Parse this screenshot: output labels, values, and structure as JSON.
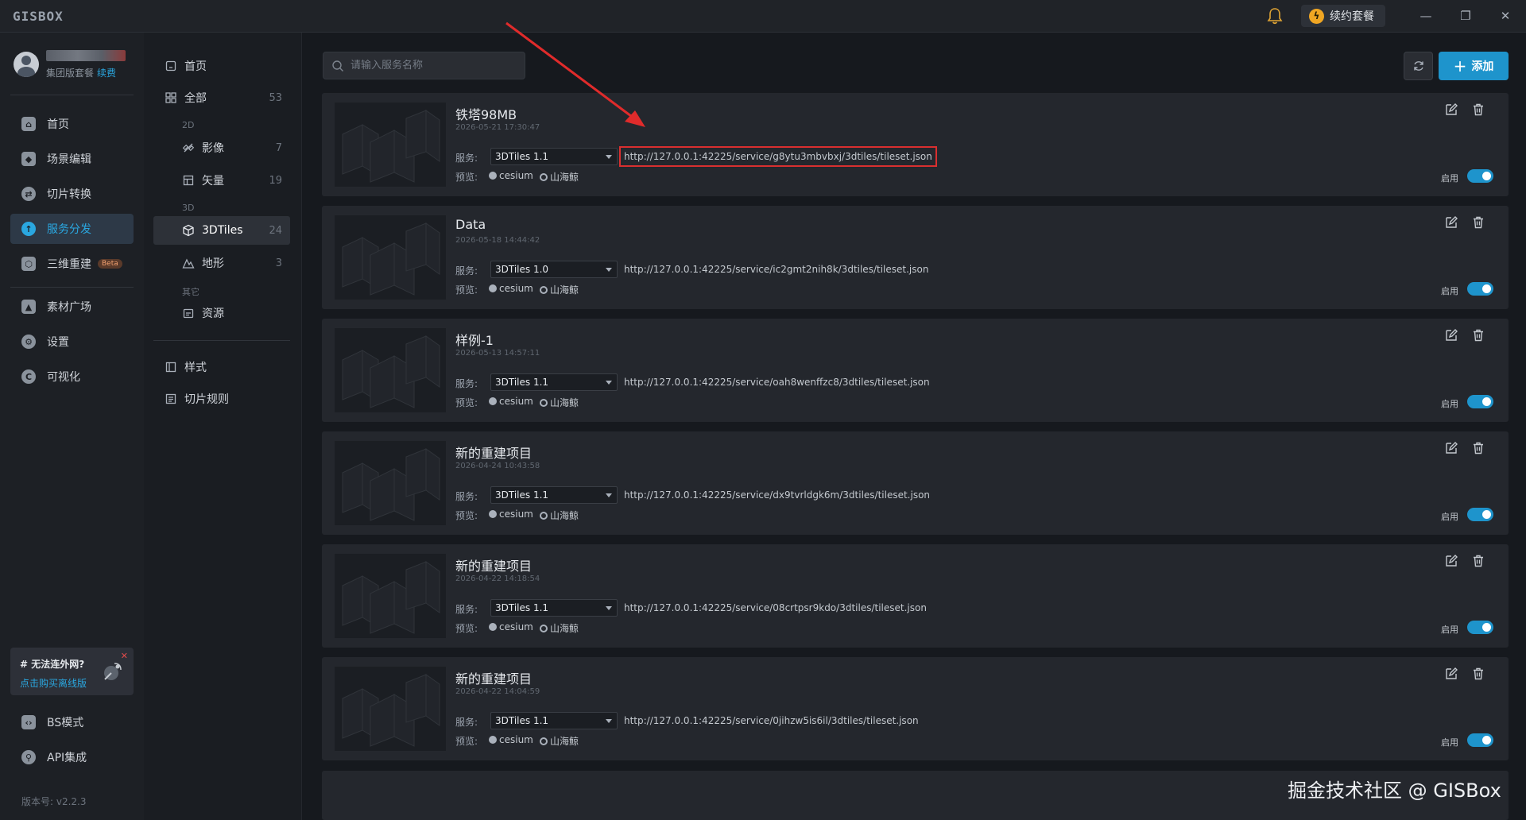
{
  "app": {
    "logo": "GISBOX",
    "renew_label": "续约套餐",
    "window_controls": [
      "minimize-icon",
      "restore-icon",
      "close-icon"
    ]
  },
  "user": {
    "plan": "集团版套餐",
    "renew_link": "续费"
  },
  "nav": {
    "items": [
      {
        "label": "首页",
        "icon": "home-icon"
      },
      {
        "label": "场景编辑",
        "icon": "cube-icon"
      },
      {
        "label": "切片转换",
        "icon": "convert-icon"
      },
      {
        "label": "服务分发",
        "icon": "upload-icon",
        "active": true
      },
      {
        "label": "三维重建",
        "icon": "reconstruct-icon",
        "badge": "Beta"
      },
      {
        "label": "素材广场",
        "icon": "image-icon"
      },
      {
        "label": "设置",
        "icon": "settings-icon"
      },
      {
        "label": "可视化",
        "icon": "visual-icon"
      }
    ],
    "bottom": [
      {
        "label": "BS模式",
        "icon": "code-icon"
      },
      {
        "label": "API集成",
        "icon": "api-icon"
      }
    ],
    "offline": {
      "title": "# 无法连外网?",
      "link": "点击购买离线版"
    },
    "version": "版本号: v2.2.3"
  },
  "subnav": {
    "home": "首页",
    "all": {
      "label": "全部",
      "count": "53"
    },
    "group_2d": "2D",
    "imagery": {
      "label": "影像",
      "count": "7"
    },
    "vector": {
      "label": "矢量",
      "count": "19"
    },
    "group_3d": "3D",
    "tiles": {
      "label": "3DTiles",
      "count": "24"
    },
    "terrain": {
      "label": "地形",
      "count": "3"
    },
    "group_other": "其它",
    "resource": "资源",
    "style": "样式",
    "tile_rule": "切片规则"
  },
  "toolbar": {
    "search_placeholder": "请输入服务名称",
    "add_label": "添加"
  },
  "labels": {
    "service": "服务:",
    "preview": "预览:",
    "cesium": "cesium",
    "shanhai": "山海鲸",
    "enable": "启用"
  },
  "services": [
    {
      "name": "铁塔98MB",
      "date": "2026-05-21 17:30:47",
      "version": "3DTiles 1.1",
      "url": "http://127.0.0.1:42225/service/g8ytu3mbvbxj/3dtiles/tileset.json",
      "enabled": true,
      "highlighted": true
    },
    {
      "name": "Data",
      "date": "2026-05-18 14:44:42",
      "version": "3DTiles 1.0",
      "url": "http://127.0.0.1:42225/service/ic2gmt2nih8k/3dtiles/tileset.json",
      "enabled": true
    },
    {
      "name": "样例-1",
      "date": "2026-05-13 14:57:11",
      "version": "3DTiles 1.1",
      "url": "http://127.0.0.1:42225/service/oah8wenffzc8/3dtiles/tileset.json",
      "enabled": true
    },
    {
      "name": "新的重建项目",
      "date": "2026-04-24 10:43:58",
      "version": "3DTiles 1.1",
      "url": "http://127.0.0.1:42225/service/dx9tvrldgk6m/3dtiles/tileset.json",
      "enabled": true
    },
    {
      "name": "新的重建项目",
      "date": "2026-04-22 14:18:54",
      "version": "3DTiles 1.1",
      "url": "http://127.0.0.1:42225/service/08crtpsr9kdo/3dtiles/tileset.json",
      "enabled": true
    },
    {
      "name": "新的重建项目",
      "date": "2026-04-22 14:04:59",
      "version": "3DTiles 1.1",
      "url": "http://127.0.0.1:42225/service/0jihzw5is6il/3dtiles/tileset.json",
      "enabled": true
    }
  ],
  "watermark": "掘金技术社区 @ GISBox",
  "colors": {
    "accent": "#1e94cc",
    "highlight": "#d92f2f",
    "bell": "#e0a434"
  }
}
